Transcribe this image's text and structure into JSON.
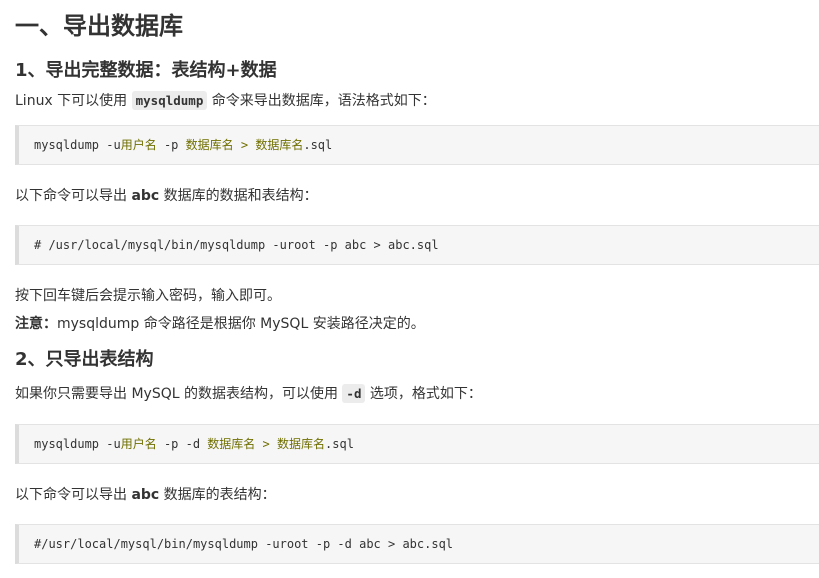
{
  "title": "一、导出数据库",
  "section1": {
    "heading": "1、导出完整数据：表结构+数据",
    "intro_before": "Linux 下可以使用 ",
    "intro_code": "mysqldump",
    "intro_after": " 命令来导出数据库，语法格式如下：",
    "code": {
      "cmd": "mysqldump -u",
      "user": "用户名",
      "opt": " -p ",
      "db": "数据库名",
      "redirect": " > ",
      "file": "数据库名",
      "ext": ".sql"
    },
    "example_before": "以下命令可以导出 ",
    "example_bold": "abc",
    "example_after": " 数据库的数据和表结构：",
    "example_code": "# /usr/local/mysql/bin/mysqldump -uroot -p abc > abc.sql",
    "after_text": "按下回车键后会提示输入密码，输入即可。",
    "note_label": "注意：",
    "note_text": "mysqldump 命令路径是根据你 MySQL 安装路径决定的。"
  },
  "section2": {
    "heading": "2、只导出表结构",
    "intro_before": "如果你只需要导出 MySQL 的数据表结构，可以使用 ",
    "intro_code": "-d",
    "intro_after": " 选项，格式如下：",
    "code": {
      "cmd": "mysqldump -u",
      "user": "用户名",
      "opt": " -p -d ",
      "db": "数据库名",
      "redirect": " > ",
      "file": "数据库名",
      "ext": ".sql"
    },
    "example_before": "以下命令可以导出 ",
    "example_bold": "abc",
    "example_after": " 数据库的表结构：",
    "example_code": "#/usr/local/mysql/bin/mysqldump -uroot -p -d abc > abc.sql"
  }
}
